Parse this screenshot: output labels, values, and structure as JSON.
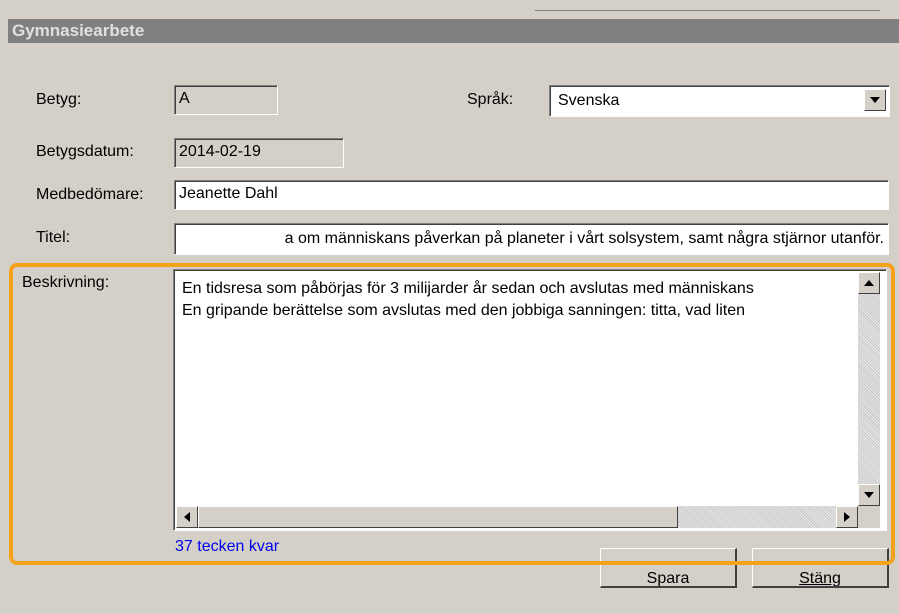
{
  "window": {
    "title": "Gymnasiearbete"
  },
  "form": {
    "betyg_label": "Betyg:",
    "betyg_value": "A",
    "sprak_label": "Språk:",
    "sprak_value": "Svenska",
    "betygsdatum_label": "Betygsdatum:",
    "betygsdatum_value": "2014-02-19",
    "medbedomare_label": "Medbedömare:",
    "medbedomare_value": "Jeanette Dahl",
    "titel_label": "Titel:",
    "titel_value": "a om människans påverkan på planeter i vårt solsystem, samt några stjärnor utanför.",
    "beskrivning_label": "Beskrivning:",
    "beskrivning_lines": [
      "En tidsresa som påbörjas för 3 milijarder år sedan och avslutas med människans",
      "En gripande berättelse som avslutas med den jobbiga sanningen: titta, vad liten"
    ],
    "chars_left": "37 tecken kvar"
  },
  "buttons": {
    "save_label": "Spara",
    "close_label": "Stäng"
  },
  "colors": {
    "highlight": "#f5a21b",
    "counter_text": "#0000ee"
  }
}
